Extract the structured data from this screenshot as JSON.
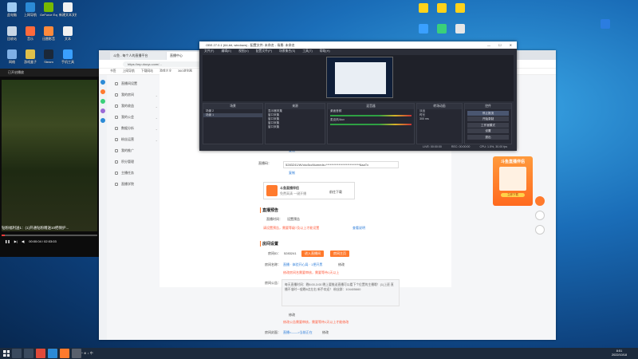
{
  "desktop": {
    "icons_left": [
      {
        "label": "此电脑",
        "color": "#9ecbf3"
      },
      {
        "label": "上网导航",
        "color": "#2b8ad6"
      },
      {
        "label": "GeForce Experience",
        "color": "#76b900"
      },
      {
        "label": "新建文本文档",
        "color": "#f1f1f1"
      },
      {
        "label": "回收站",
        "color": "#c9d7e6"
      },
      {
        "label": "音乐",
        "color": "#ff6a3c"
      },
      {
        "label": "迅雷影音",
        "color": "#ff8a3c"
      },
      {
        "label": "文本",
        "color": "#f1f1f1"
      },
      {
        "label": "网络",
        "color": "#7fb0e6"
      },
      {
        "label": "游戏盒子",
        "color": "#e0c04a"
      },
      {
        "label": "Steam",
        "color": "#1b2838"
      },
      {
        "label": "手机工具",
        "color": "#3aa0ff"
      }
    ],
    "icons_right": [
      {
        "label": "",
        "color": "#ffd21a"
      },
      {
        "label": "",
        "color": "#ffd21a"
      },
      {
        "label": "",
        "color": "#ffd21a"
      },
      {
        "label": "",
        "color": "#3aa0ff"
      },
      {
        "label": "",
        "color": "#3ad07a"
      },
      {
        "label": "",
        "color": "#e6e6e6"
      },
      {
        "label": "",
        "color": "#2b7de0"
      }
    ]
  },
  "video_player": {
    "title": "已开启播放",
    "subtitle": "钻粉福利送1：(1)开通钻粉赠送10把保护...",
    "time": "00:00:04 / 02:03:03",
    "progress": 0.03
  },
  "browser": {
    "tabs": [
      "斗鱼 - 每个人的直播平台",
      "直播中心"
    ],
    "url": "https://mp.douyu.com/...",
    "bookmarks": [
      "书签",
      "上网导航",
      "下载网站",
      "游戏大全",
      "360浏览器"
    ],
    "left_nav": [
      "直播间设置",
      "我的房间",
      "我的收益",
      "我的公会",
      "数据分析",
      "粉丝运营",
      "我的推广",
      "积分管理",
      "主播任务",
      "直播学院"
    ],
    "content": {
      "copy_label": "复制",
      "stream_code_label": "直播码：",
      "stream_code_value": "5283241/W/ckc5ccNumeds=***************************6aaTx",
      "copy_label_2": "复制",
      "obs_card_title": "斗鱼直播伴侣",
      "obs_card_sub": "免费高清 一键开播",
      "obs_card_btn": "前往下载",
      "section1": "直播预告",
      "preview_label": "直播时间：",
      "preview_value": "设置预告",
      "preview_hint": "请设置预告，需要等级7及以上才能设置",
      "preview_link": "查看说明",
      "section2": "房间设置",
      "room_label": "房间ID：",
      "room_value": "5283241",
      "room_btn1": "进入直播间",
      "room_btn2": "房间主页",
      "name_label": "房间名称：",
      "name_value": "直播 · 体验开心局 · 1把开黑",
      "name_edit": "修改",
      "name_hint": "修改房间名需要审核，需要等待1天以上",
      "intro_label": "房间公告：",
      "intro_text": "每天直播时间：晚8:00-3:00 晚上要推送直播可以看下个位置的主播哦！(1)上班 直播不准时一般晚8点左右 新手欢迎！ 粉丝群：104405660",
      "intro_edit": "修改",
      "intro_hint": "修改公告需要审核，需要等待1天以上才能修改",
      "cover_label": "房间封面：",
      "cover_value": "直播<——>当前正在",
      "cover_edit": "修改"
    },
    "promo": {
      "title": "斗鱼直播伴侣",
      "cta": "立即下载"
    }
  },
  "obs": {
    "title": "OBS 27.0.1 (64-bit, windows) - 配置文件: 未命名 - 场景: 未命名",
    "menu": [
      "文件(F)",
      "编辑(E)",
      "视图(V)",
      "配置文件(P)",
      "场景集合(S)",
      "工具(T)",
      "帮助(H)"
    ],
    "win_buttons": [
      "—",
      "☐",
      "✕"
    ],
    "docks": {
      "scenes_title": "场景",
      "scenes": [
        "场景 2",
        "场景 1"
      ],
      "sources_title": "来源",
      "sources": [
        "显示器采集",
        "窗口采集",
        "窗口采集",
        "窗口采集",
        "窗口采集"
      ],
      "mixer_title": "混音器",
      "mixer": [
        "桌面音频",
        "麦克风/Aux"
      ],
      "transitions_title": "转场动画",
      "transition_name": "淡出",
      "duration_label": "时长",
      "duration_value": "300 ms",
      "controls_title": "控件",
      "controls": [
        "停止推流",
        "开始录制",
        "工作室模式",
        "设置",
        "退出"
      ]
    },
    "status": [
      "LIVE: 00:00:00",
      "REC: 00:00:00",
      "CPU: 1.5%, 30.00 fps"
    ]
  },
  "taskbar": {
    "time": "8:51",
    "date": "2022/10/18",
    "tray": "^ ⊕ ♪ 中"
  }
}
